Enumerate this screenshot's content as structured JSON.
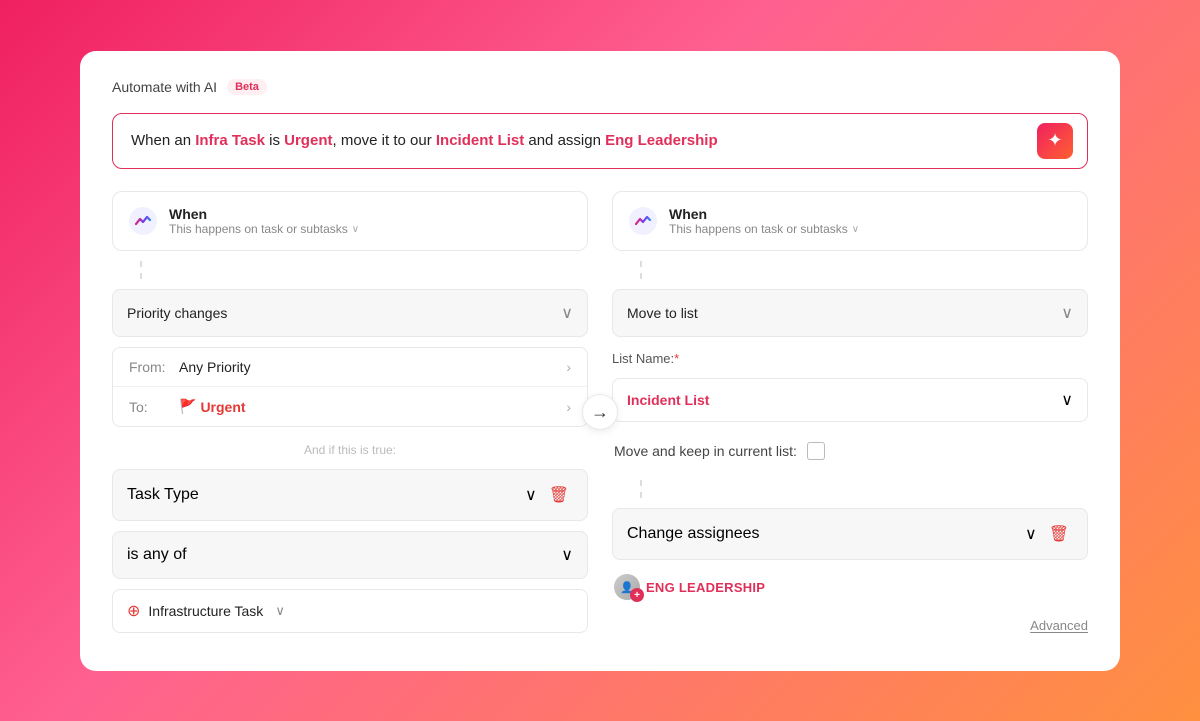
{
  "header": {
    "automate_label": "Automate with AI",
    "beta_label": "Beta"
  },
  "prompt": {
    "text_static": "When an",
    "infra_task": "Infra Task",
    "is_text": "is",
    "urgent": "Urgent",
    "move_text": ", move it to our",
    "incident_list": "Incident List",
    "and_text": "and assign",
    "eng_leadership": "Eng Leadership"
  },
  "left_column": {
    "when_label": "When",
    "when_sub": "This happens on task or subtasks",
    "trigger_label": "Priority changes",
    "from_label": "From:",
    "from_value": "Any Priority",
    "to_label": "To:",
    "urgent_value": "Urgent",
    "and_if_label": "And if this is true:",
    "task_type_label": "Task Type",
    "is_any_of_label": "is any of",
    "infra_task_label": "Infrastructure Task"
  },
  "right_column": {
    "when_label": "When",
    "when_sub": "This happens on task or subtasks",
    "action_label": "Move to list",
    "list_name_label": "List Name:",
    "list_name_req": "*",
    "incident_list_value": "Incident List",
    "keep_list_label": "Move and keep in current list:",
    "change_assignees_label": "Change assignees",
    "eng_leadership_label": "ENG LEADERSHIP",
    "advanced_label": "Advanced"
  },
  "arrow": "→",
  "icons": {
    "chevron_down": "∨",
    "chevron_right": "›",
    "spark": "✦",
    "trash": "🗑",
    "globe": "⊕"
  }
}
